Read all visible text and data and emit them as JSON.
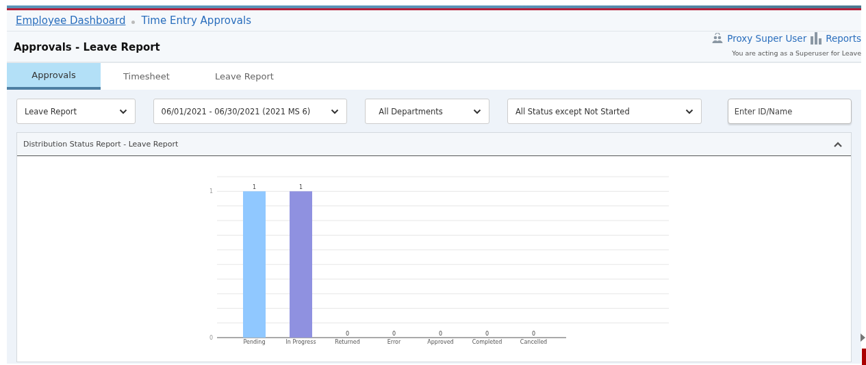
{
  "breadcrumb": [
    {
      "label": "Employee Dashboard",
      "kind": "link"
    },
    {
      "label": "Time Entry Approvals",
      "kind": "current"
    }
  ],
  "page_title": "Approvals - Leave Report",
  "header_links": [
    {
      "label": "Proxy Super User",
      "kind": "proxy"
    },
    {
      "label": "Reports",
      "kind": "reports"
    }
  ],
  "notice": "You are acting as a Superuser for Leave",
  "tabs": [
    {
      "label": "Approvals",
      "selected": true
    },
    {
      "label": "Timesheet",
      "selected": false
    },
    {
      "label": "Leave Report",
      "selected": false
    }
  ],
  "filters": [
    {
      "kind": "select",
      "value": "Leave Report"
    },
    {
      "kind": "select",
      "value": "06/01/2021 - 06/30/2021 (2021 MS 6)"
    },
    {
      "kind": "select",
      "value": "All Departments"
    },
    {
      "kind": "select",
      "value": "All Status except Not Started"
    },
    {
      "kind": "input",
      "placeholder": "Enter ID/Name"
    }
  ],
  "panel": {
    "title": "Distribution Status Report - Leave Report",
    "expanded": true,
    "chart_data": {
      "type": "bar",
      "categories": [
        "Pending",
        "In Progress",
        "Returned",
        "Error",
        "Approved",
        "Completed",
        "Cancelled"
      ],
      "values": [
        1,
        1,
        0,
        0,
        0,
        0,
        0
      ],
      "ylim": [
        0,
        1.1
      ],
      "yticks": [
        0,
        1
      ],
      "data_labels": true
    }
  }
}
